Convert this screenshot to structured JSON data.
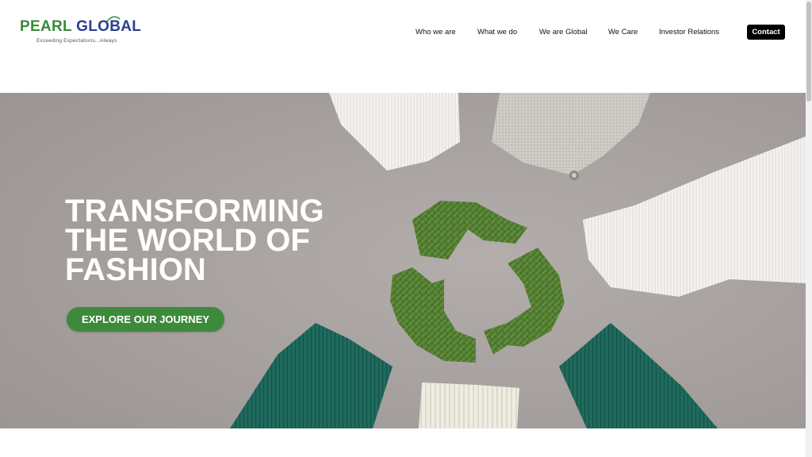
{
  "brand": {
    "word_pearl": "PEARL",
    "word_global": "GLOBAL",
    "tagline": "Exceeding Expectations...Always",
    "color_green": "#3a8a3a",
    "color_blue": "#2a3f8f"
  },
  "nav": {
    "items": [
      {
        "label": "Who we are"
      },
      {
        "label": "What we do"
      },
      {
        "label": "We are Global"
      },
      {
        "label": "We Care"
      },
      {
        "label": "Investor Relations"
      }
    ],
    "contact_label": "Contact"
  },
  "hero": {
    "title_lines": [
      "TRANSFORMING",
      "THE WORLD OF",
      "FASHION"
    ],
    "cta_label": "EXPLORE OUR JOURNEY",
    "cta_color": "#3e8a3c",
    "image_subject": "recycle-symbol-of-pine-needles-with-knit-sleeves"
  }
}
